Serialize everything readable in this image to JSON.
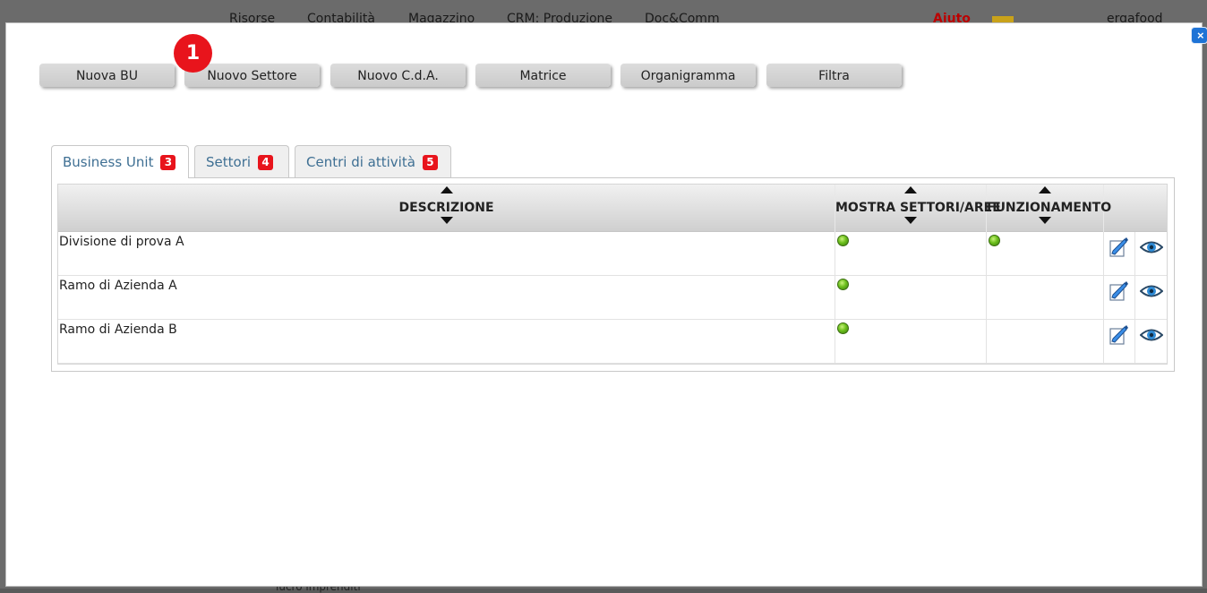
{
  "background": {
    "menu": [
      "Risorse",
      "Contabilità",
      "Magazzino",
      "CRM: Produzione",
      "Doc&Comm"
    ],
    "help_label": "Aiuto",
    "user": "ergafood",
    "footer_text": "lucro imprenditi"
  },
  "modal": {
    "close_label": "×",
    "step_badge": "1",
    "toolbar": [
      {
        "label": "Nuova BU"
      },
      {
        "label": "Nuovo Settore"
      },
      {
        "label": "Nuovo C.d.A."
      },
      {
        "label": "Matrice"
      },
      {
        "label": "Organigramma"
      },
      {
        "label": "Filtra"
      }
    ],
    "tabs": [
      {
        "label": "Business Unit",
        "badge": "3",
        "active": true
      },
      {
        "label": "Settori",
        "badge": "4",
        "active": false
      },
      {
        "label": "Centri di attività",
        "badge": "5",
        "active": false
      }
    ],
    "table": {
      "columns": [
        "DESCRIZIONE",
        "MOSTRA SETTORI/AREE",
        "FUNZIONAMENTO"
      ],
      "rows": [
        {
          "descrizione": "Divisione di prova A",
          "mostra_settori": true,
          "funzionamento": true
        },
        {
          "descrizione": "Ramo di Azienda A",
          "mostra_settori": true,
          "funzionamento": false
        },
        {
          "descrizione": "Ramo di Azienda B",
          "mostra_settori": true,
          "funzionamento": false
        }
      ],
      "row_actions": [
        "edit-icon",
        "view-icon"
      ]
    },
    "colors": {
      "badge_red": "#e8141c",
      "tab_text": "#3e6f93",
      "status_green": "#6cbf1c",
      "close_blue": "#1e73d6"
    }
  }
}
